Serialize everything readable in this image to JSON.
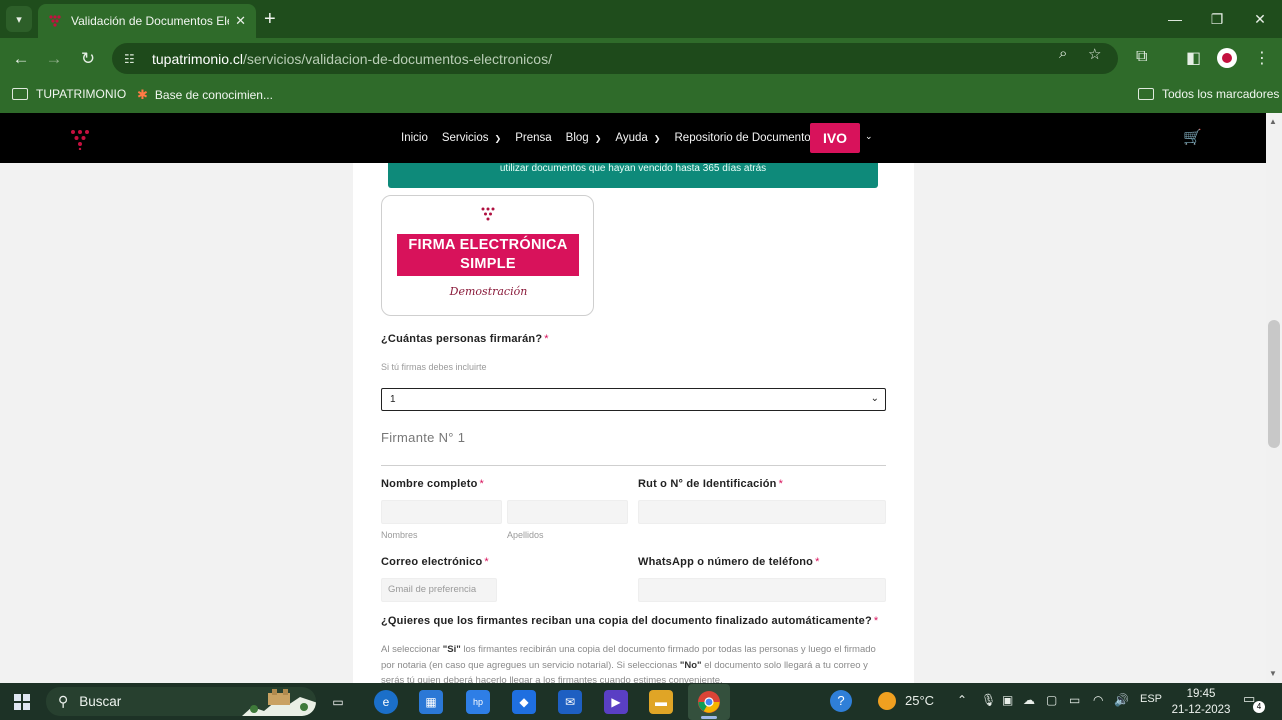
{
  "browser": {
    "tab_title": "Validación de Documentos Electrónicos",
    "tab_close": "✕",
    "new_tab": "+",
    "url_domain": "tupatrimonio.cl",
    "url_path": "/servicios/validacion-de-documentos-electronicos/",
    "bookmarks": [
      {
        "label": "TUPATRIMONIO"
      },
      {
        "label": "Base de conocimien..."
      }
    ],
    "all_bookmarks": "Todos los marcadores",
    "accent_color": "#2f6b2a"
  },
  "site": {
    "nav": [
      "Inicio",
      "Servicios",
      "Prensa",
      "Blog",
      "Ayuda",
      "Repositorio de Documentos"
    ],
    "user_button": "IVO",
    "brand_color": "#d8125b",
    "banner_text": "utilizar documentos que hayan vencido hasta 365 días atrás",
    "product_card": {
      "title_line1": "FIRMA ELECTRÓNICA",
      "title_line2": "SIMPLE",
      "subtitle": "Demostración"
    },
    "form": {
      "signers_question": "¿Cuántas personas firmarán?",
      "required_mark": "*",
      "signers_hint": "Si tú firmas debes incluirte",
      "signers_value": "1",
      "section_title": "Firmante N° 1",
      "full_name_label": "Nombre completo",
      "first_name_sublabel": "Nombres",
      "last_name_sublabel": "Apellidos",
      "rut_label": "Rut o N° de Identificación",
      "email_label": "Correo electrónico",
      "email_placeholder": "Gmail de preferencia",
      "phone_label": "WhatsApp o número de teléfono",
      "copy_question": "¿Quieres que los firmantes reciban una copia del documento finalizado automáticamente?",
      "copy_desc_1": "Al seleccionar ",
      "copy_desc_si": "\"Si\"",
      "copy_desc_2": " los firmantes recibirán una copia del documento firmado por todas las personas y luego el firmado por notaria (en caso que agregues un servicio notarial). Si seleccionas ",
      "copy_desc_no": "\"No\"",
      "copy_desc_3": " el documento solo llegará a tu correo y serás tú quien deberá hacerlo llegar a los firmantes cuando estimes conveniente."
    }
  },
  "taskbar": {
    "search_label": "Buscar",
    "temperature": "25°C",
    "language": "ESP",
    "time": "19:45",
    "date": "21-12-2023",
    "notification_count": "4"
  }
}
